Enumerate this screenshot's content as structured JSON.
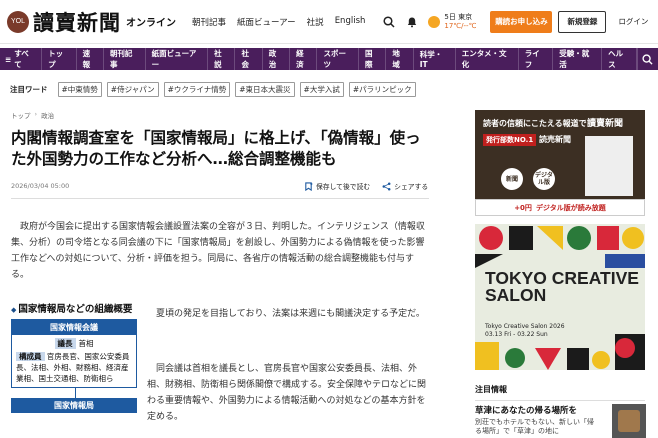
{
  "header": {
    "logo_mark": "YOL",
    "logo_text": "讀賣新聞",
    "logo_sub": "オンライン",
    "links": [
      "朝刊記事",
      "紙面ビューアー",
      "社説",
      "English"
    ],
    "weather_date": "5日 東京",
    "weather_temp": "17℃/--℃",
    "subscribe_label": "購読お申し込み",
    "register_label": "新規登録",
    "login_label": "ログイン"
  },
  "nav": {
    "all_label": "すべて",
    "items": [
      "トップ",
      "速報",
      "朝刊記事",
      "紙面ビューアー",
      "社説",
      "社会",
      "政治",
      "経済",
      "スポーツ",
      "国際",
      "地域",
      "科学・IT",
      "エンタメ・文化",
      "ライフ",
      "受験・就活",
      "ヘルス"
    ]
  },
  "tags": {
    "label": "注目ワード",
    "items": [
      "#中東情勢",
      "#侍ジャパン",
      "#ウクライナ情勢",
      "#東日本大震災",
      "#大学入試",
      "#パラリンピック"
    ]
  },
  "article": {
    "breadcrumbs": [
      "トップ",
      "政治"
    ],
    "title": "内閣情報調査室を「国家情報局」に格上げ、「偽情報」使った外国勢力の工作など分析へ…総合調整機能も",
    "date": "2026/03/04 05:00",
    "save_label": "保存して後で読む",
    "share_label": "シェアする",
    "lead": "政府が今国会に提出する国家情報会議設置法案の全容が３日、判明した。インテリジェンス（情報収集、分析）の司令塔となる同会議の下に「国家情報局」を創設し、外国勢力による偽情報を使った影響工作などへの対処について、分析・評価を担う。同局に、各省庁の情報活動の総合調整機能も付与する。",
    "para2": "夏頃の発足を目指しており、法案は来週にも閣議決定する予定だ。",
    "para3": "同会議は首相を議長とし、官房長官や国家公安委員長、法相、外相、財務相、防衛相ら関係閣僚で構成する。安全保障やテロなどに関わる重要情報や、外国勢力による情報活動への対処などの基本方針を定める。"
  },
  "org_chart": {
    "title": "国家情報局などの組織概要",
    "box_head": "国家情報会議",
    "chair_chip": "議長",
    "chair_value": "首相",
    "members_chip": "構成員",
    "members_text": "官房長官、国家公安委員長、法相、外相、財務相、経済産業相、国土交通相、防衛相ら",
    "bureau_head": "国家情報局"
  },
  "sidebar": {
    "ad1_top": "読者の信頼にこたえる報道で",
    "ad1_logo": "讀賣新聞",
    "ad1_badge": "発行部数NO.1",
    "ad1_badge2": "読売新聞",
    "ad1_circle1": "新聞",
    "ad1_circle2": "デジタル版",
    "ad1_bottom_prefix": "+0円",
    "ad1_bottom": "デジタル版が読み放題",
    "ad2_title": "TOKYO CREATIVE SALON",
    "ad2_sub1": "Tokyo Creative Salon 2026",
    "ad2_sub2": "03.13 Fri - 03.22 Sun",
    "section_title": "注目情報",
    "item_title": "草津にあなたの帰る場所を",
    "item_sub": "別荘でもホテルでもない、新しい「帰る場所」で「草津」の地に"
  },
  "colors": {
    "nav_bg": "#4a1e5c",
    "subscribe_bg": "#ef7d1a",
    "chart_blue": "#1e5aa0"
  }
}
